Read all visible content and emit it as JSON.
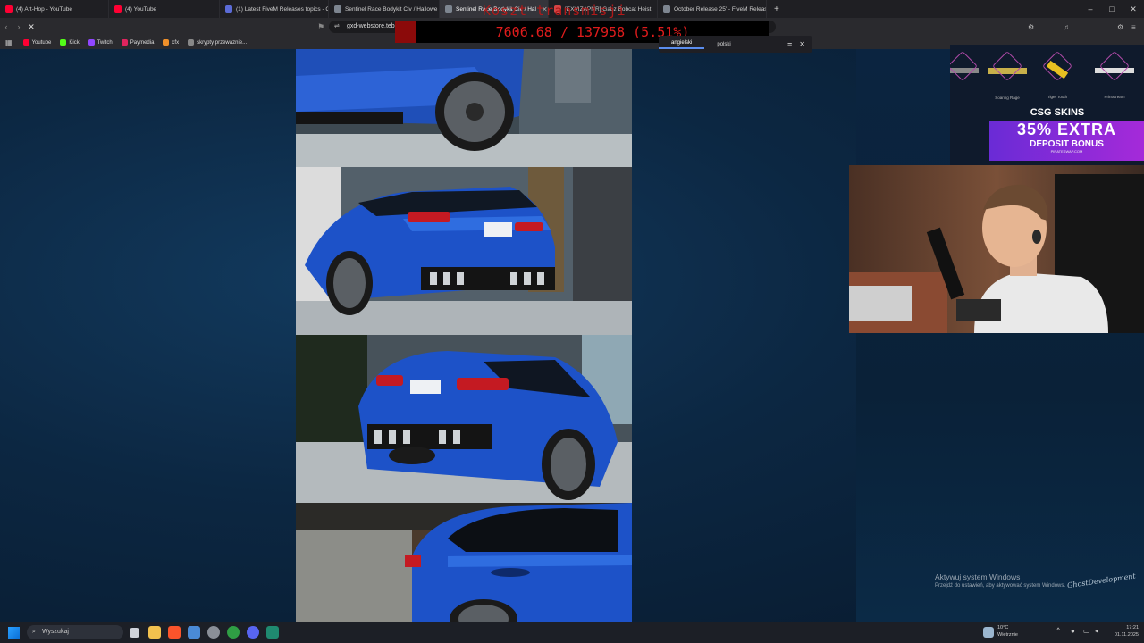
{
  "browser": {
    "tabs": [
      {
        "label": "(4) Art-Hop - YouTube",
        "color": "#ff0033"
      },
      {
        "label": "(4) YouTube",
        "color": "#ff0033"
      },
      {
        "label": "(1) Latest FiveM Releases topics - Cfx",
        "color": "#5b6bd6"
      },
      {
        "label": "Sentinel Race Bodykit Civ / Hallowe",
        "color": "#7d8590"
      },
      {
        "label": "Sentinel Race Bodykit Civ / Hal",
        "color": "#7d8590",
        "active": true
      },
      {
        "label": "[EXVIZAPNR] Gabz Bobcat Heist",
        "color": "#d64545"
      },
      {
        "label": "October Release 25' - FiveM Release",
        "color": "#7d8590"
      }
    ],
    "window_controls": [
      "–",
      "□",
      "✕"
    ],
    "url": "gxd-webstore.tebex",
    "bookmarks": [
      {
        "label": "Youtube",
        "color": "#ff0033"
      },
      {
        "label": "Kick",
        "color": "#53fc18"
      },
      {
        "label": "Twitch",
        "color": "#9146ff"
      },
      {
        "label": "Paymedia",
        "color": "#e0245e"
      },
      {
        "label": "cfx",
        "color": "#f0902a"
      },
      {
        "label": "skrypty przewaznie...",
        "color": "#888888"
      }
    ]
  },
  "overlay": {
    "title": "Koszt transmisji",
    "stats": "7606.68 / 137958 (5.51%)"
  },
  "translate": {
    "options": [
      "angielski",
      "polski"
    ],
    "selected": "angielski"
  },
  "ad": {
    "items": [
      "Soaring Rage",
      "Tiger Tooth",
      "Printstream"
    ],
    "brand": "CSG SKINS",
    "headline": "35% EXTRA",
    "subline": "DEPOSIT BONUS",
    "site": "PIRATESWAP.COM"
  },
  "watermark": {
    "line1": "Aktywuj system Windows",
    "line2": "Przejdź do ustawień, aby aktywować system Windows.",
    "signature": "GhostDevelopment"
  },
  "taskbar": {
    "search_placeholder": "Wyszukaj",
    "weather_temp": "10°C",
    "weather_desc": "Wietrznie",
    "time": "17:21",
    "date": "01.11.2025"
  }
}
